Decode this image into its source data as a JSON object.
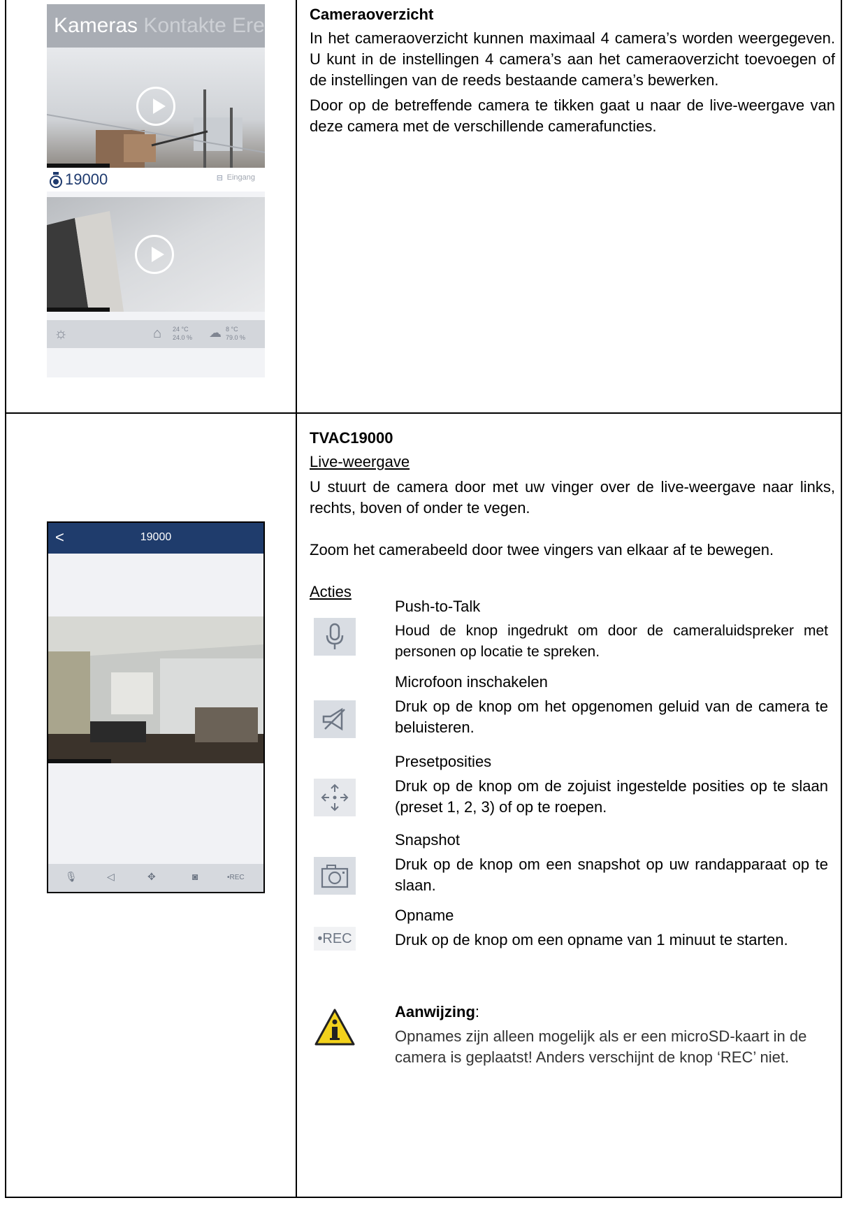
{
  "row1": {
    "phone": {
      "tabs": [
        "Kameras",
        "Kontakte",
        "Ereig"
      ],
      "camera1": {
        "id": "19000",
        "location": "Eingang"
      },
      "weather": {
        "indoor_temp": "24 °C",
        "indoor_hum": "24.0 %",
        "outdoor_temp": "8 °C",
        "outdoor_hum": "79.0 %"
      }
    },
    "heading": "Cameraoverzicht",
    "p1": "In het cameraoverzicht kunnen maximaal 4 camera’s worden weergegeven. U kunt in de instellingen 4 camera’s aan het cameraoverzicht toevoegen of de instellingen van de reeds bestaande camera’s bewerken.",
    "p2": "Door op de betreffende camera te tikken gaat u naar de live-weergave van deze camera met de verschillende camerafuncties."
  },
  "row2": {
    "phone": {
      "back": "<",
      "title": "19000",
      "rec": "•REC"
    },
    "heading": "TVAC19000",
    "live_label": "Live-weergave",
    "p1": "U stuurt de camera door met uw vinger over de live-weergave naar links, rechts, boven of onder te vegen.",
    "p2": "Zoom het camerabeeld door twee vingers van elkaar af te bewegen.",
    "actions_label": "Acties",
    "actions": [
      {
        "title": "Push-to-Talk",
        "desc": "Houd de knop ingedrukt om door de cameraluidspreker met personen op locatie te spreken.",
        "icon": "microphone-icon"
      },
      {
        "title": "Microfoon inschakelen",
        "desc": "Druk op de knop om het opgenomen geluid van de camera te beluisteren.",
        "icon": "speaker-muted-icon"
      },
      {
        "title": "Presetposities",
        "desc": "Druk op de knop om de zojuist ingestelde posities op te slaan (preset 1, 2, 3) of op te roepen.",
        "icon": "preset-arrows-icon"
      },
      {
        "title": "Snapshot",
        "desc": "Druk op de knop om een snapshot op uw randapparaat op te slaan.",
        "icon": "camera-icon"
      },
      {
        "title": "Opname",
        "desc": "Druk op de knop om een opname van 1 minuut te starten.",
        "icon": "rec-icon",
        "icon_text": "•REC"
      }
    ],
    "note": {
      "title": "Aanwijzing",
      "colon": ":",
      "text": "Opnames zijn alleen mogelijk als er een microSD-kaart in de camera is geplaatst! Anders verschijnt de knop ‘REC’ niet."
    }
  }
}
